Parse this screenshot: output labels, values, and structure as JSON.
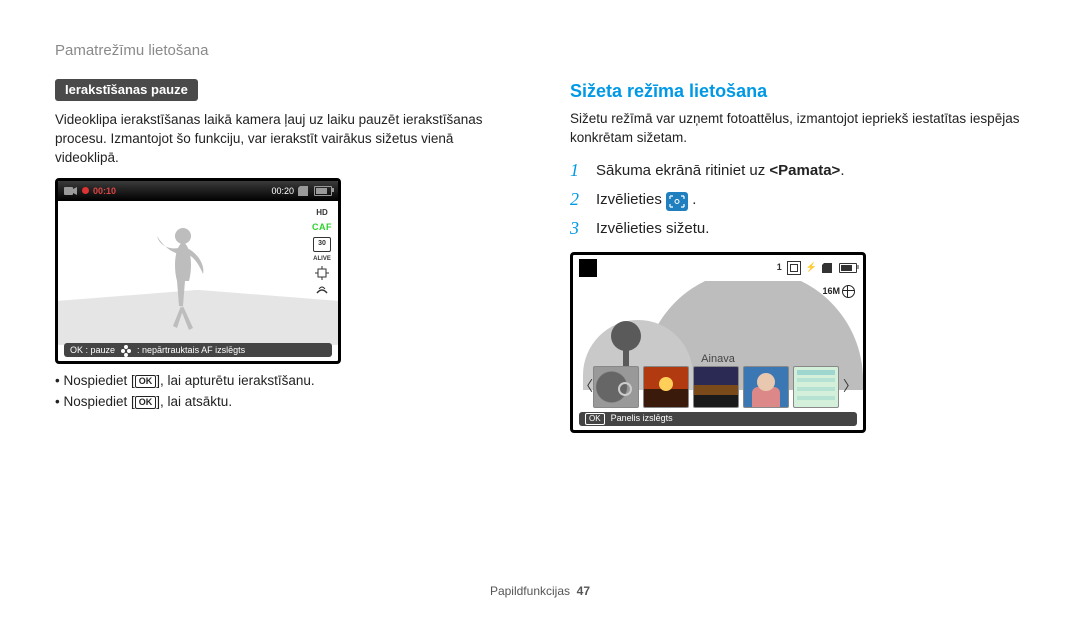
{
  "breadcrumb": "Pamatrežīmu lietošana",
  "left": {
    "tag": "Ierakstīšanas pauze",
    "paragraph": "Videoklipa ierakstīšanas laikā kamera ļauj uz laiku pauzēt ierakstīšanas procesu. Izmantojot šo funkciju, var ierakstīt vairākus sižetus vienā videoklipā.",
    "lcd": {
      "time_elapsed": "00:10",
      "time_total": "00:20",
      "hd": "HD",
      "caf": "CAF",
      "fps": "30",
      "alive": "ALIVE",
      "bottom_ok": "OK : pauze",
      "bottom_af": ": nepārtrauktais AF izslēgts"
    },
    "bullet1_pre": "• Nospiediet [",
    "bullet1_ok": "OK",
    "bullet1_post": "], lai apturētu ierakstīšanu.",
    "bullet2_pre": "• Nospiediet [",
    "bullet2_ok": "OK",
    "bullet2_post": "], lai atsāktu."
  },
  "right": {
    "title": "Sižeta režīma lietošana",
    "paragraph": "Sižetu režīmā var uzņemt fotoattēlus, izmantojot iepriekš iestatītas iespējas konkrētam sižetam.",
    "step1_pre": "Sākuma ekrānā ritiniet uz ",
    "step1_bold": "<Pamata>",
    "step1_post": ".",
    "step2_pre": "Izvēlieties ",
    "step2_post": " .",
    "step3": "Izvēlieties sižetu.",
    "lcd": {
      "count": "1",
      "res": "16M",
      "thumb_label": "Ainava",
      "bar_ok": "OK",
      "bar_text": "Panelis izslēgts"
    }
  },
  "footer": {
    "label": "Papildfunkcijas",
    "page": "47"
  }
}
